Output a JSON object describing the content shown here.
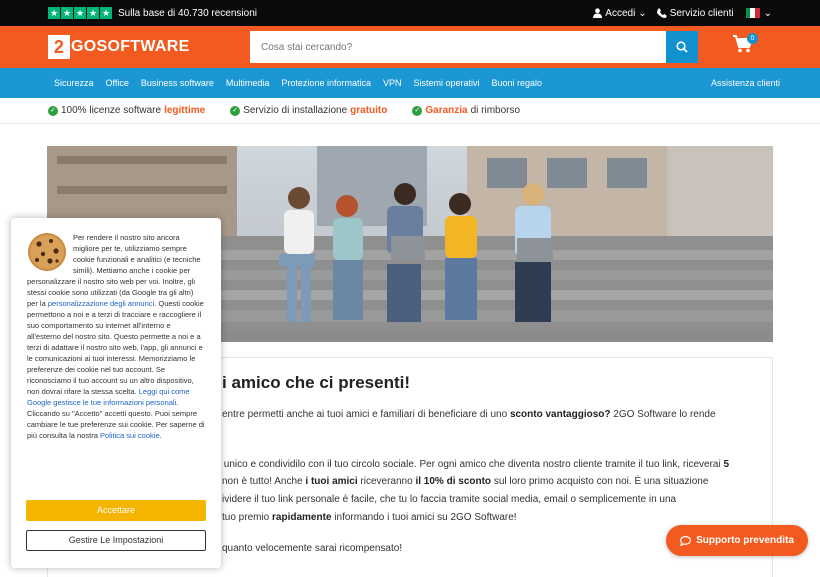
{
  "topbar": {
    "reviews_text": "Sulla base di 40.730 recensioni",
    "account_label": "Accedi",
    "service_label": "Servizio clienti"
  },
  "header": {
    "logo_mark": "2",
    "logo_text": "GOSOFTWARE",
    "search_placeholder": "Cosa stai cercando?",
    "cart_count": "0"
  },
  "nav": {
    "items": [
      "Sicurezza",
      "Office",
      "Business software",
      "Multimedia",
      "Protezione informatica",
      "VPN",
      "Sistemi operativi",
      "Buoni regalo"
    ],
    "right": "Assistenza clienti"
  },
  "usp": [
    {
      "pre": "100% licenze software",
      "hl": "legittime",
      "post": ""
    },
    {
      "pre": "Servizio di installazione",
      "hl": "gratuito",
      "post": ""
    },
    {
      "pre": "",
      "hl": "Garanzia",
      "post": "di rimborso"
    }
  ],
  "main": {
    "headline": "i amico che ci presenti!",
    "p1a": "entre permetti anche ai tuoi amici e familiari di beneficiare di uno",
    "p1b": "sconto vantaggioso?",
    "p1c": "2GO Software lo rende",
    "p2a": "x unico e condividilo con il tuo circolo sociale. Per ogni amico che diventa nostro cliente tramite il tuo link, riceverai",
    "p2b": "5",
    "p3a": "non è tutto! Anche",
    "p3b": "i tuoi amici",
    "p3c": "riceveranno",
    "p3d": "il 10% di sconto",
    "p3e": "sul loro primo acquisto con noi. È una situazione",
    "p4": "ividere il tuo link personale è facile, che tu lo faccia tramite social media, email o semplicemente in una",
    "p5a": "tuo premio",
    "p5b": "rapidamente",
    "p5c": "informando i tuoi amici su 2GO Software!",
    "p6": "quanto velocemente sarai ricompensato!"
  },
  "cookie": {
    "text1": "Per rendere il nostro sito ancora migliore per te, utilizziamo sempre cookie funzionali e analitici (e tecniche simili). Mettiamo anche i cookie per personalizzare il nostro sito web per voi. Inoltre, gli stessi cookie sono utilizzati (da Google tra gli altri) per la",
    "link1": "personalizzazione degli annunci",
    "text2": ". Questi cookie permettono a noi e a terzi di tracciare e raccogliere il suo comportamento su internet all'interno e all'esterno del nostro sito. Questo permette a noi e a terzi di adattare il nostro sito web, l'app, gli annunci e le comunicazioni ai tuoi interessi. Memorizziamo le preferenze dei cookie nel tuo account. Se riconosciamo il tuo account su un altro dispositivo, non dovrai rifare la stessa scelta.",
    "link2": "Leggi qui come Google gestisce le tue informazioni personali",
    "text3": ". Cliccando su \"Accetto\" accetti questo. Puoi sempre cambiare le tue preferenze sui cookie. Per saperne di più consulta la nostra",
    "link3": "Politica sui cookie",
    "text4": ".",
    "accept_label": "Accettare",
    "settings_label": "Gestire Le Impostazioni"
  },
  "support_label": "Supporto prevendita",
  "colors": {
    "brand_orange": "#f35a1f",
    "nav_blue": "#1b97d4",
    "accept_yellow": "#f5b400",
    "trust_green": "#00b67a"
  }
}
